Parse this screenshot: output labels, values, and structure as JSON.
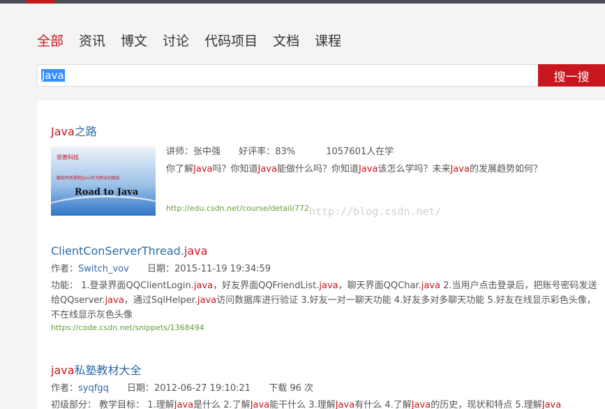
{
  "nav": {
    "tabs": [
      {
        "label": "全部",
        "active": true
      },
      {
        "label": "资讯"
      },
      {
        "label": "博文"
      },
      {
        "label": "讨论"
      },
      {
        "label": "代码项目"
      },
      {
        "label": "文档"
      },
      {
        "label": "课程"
      }
    ]
  },
  "search": {
    "value": "Java",
    "button_label": "搜一搜"
  },
  "results": [
    {
      "title_hl": "Java",
      "title_rest": "之路",
      "lecturer_label": "讲师：",
      "lecturer": "张中强",
      "rating_label": "好评率：",
      "rating": "83%",
      "students": "1057601人在学",
      "desc": [
        "你了解",
        "Java",
        "吗？你知道",
        "Java",
        "能做什么吗？你知道",
        "Java",
        "该怎么学吗？未来",
        "Java",
        "的发展趋势如何？"
      ],
      "url": "http://edu.csdn.net/course/detail/772",
      "thumb": {
        "brand": "领普科技",
        "tagline": "献给所有想将Java作为职业的朋友",
        "title": "Road to Java"
      }
    },
    {
      "title_pre": "ClientConServerThread.",
      "title_hl": "java",
      "author_label": "作者：",
      "author": "Switch_vov",
      "date_label": "日期：",
      "date": "2015-11-19 19:34:59",
      "desc": [
        "功能： 1.登录界面QQClientLogin.",
        "java",
        "，好友界面QQFriendList.",
        "java",
        "，聊天界面QQChar.",
        "java",
        " 2.当用户点击登录后，把账号密码发送给QQserver.",
        "java",
        "，通过SqlHelper.",
        "java",
        "访问数据库进行验证 3.好友一对一聊天功能 4.好友多对多聊天功能 5.好友在线显示彩色头像，不在线显示灰色头像"
      ],
      "url": "https://code.csdn.net/snippets/1368494"
    },
    {
      "title_hl": "java",
      "title_rest": "私塾教材大全",
      "author_label": "作者：",
      "author": "syqfgq",
      "date_label": "日期：",
      "date": "2012-06-27 19:10:21",
      "downloads": "下载 96 次",
      "desc": [
        "初级部分： 教学目标： 1.理解",
        "Java",
        "是什么 2.了解",
        "Java",
        "能干什么 3.理解",
        "Java",
        "有什么 4.了解",
        "Java",
        "的历史，现状和特点 5.理解",
        "Java"
      ]
    }
  ],
  "watermark": "http://blog.csdn.net/"
}
